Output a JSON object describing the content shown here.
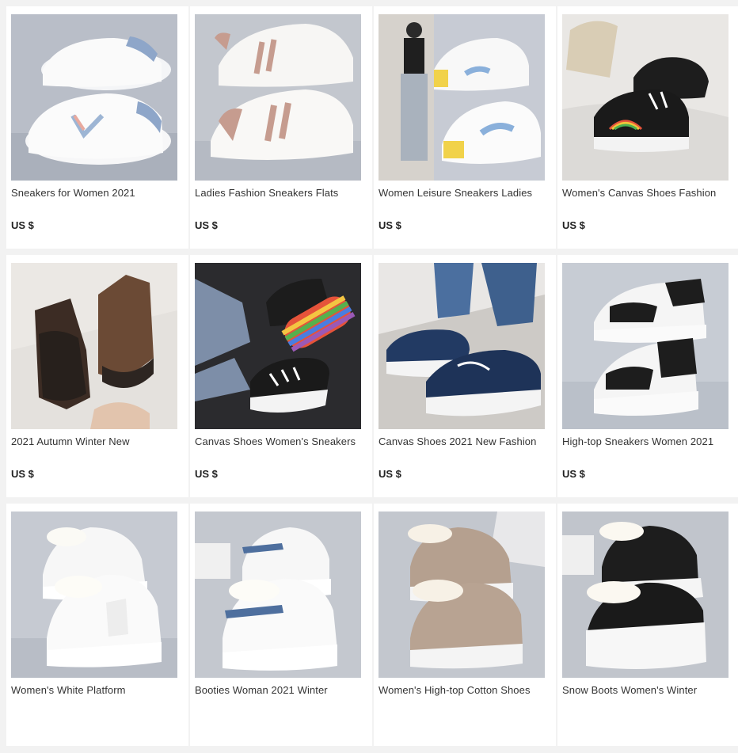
{
  "products": [
    {
      "title": "Sneakers for Women 2021",
      "price": "US $",
      "image_icon": "white-sneaker-blue-v-image"
    },
    {
      "title": "Ladies Fashion Sneakers Flats",
      "price": "US $",
      "image_icon": "white-sneaker-pink-stripes-image"
    },
    {
      "title": "Women Leisure Sneakers Ladies",
      "price": "US $",
      "image_icon": "white-sneaker-yellow-blue-image"
    },
    {
      "title": "Women's Canvas Shoes Fashion",
      "price": "US $",
      "image_icon": "black-canvas-rainbow-image"
    },
    {
      "title": "2021 Autumn Winter New",
      "price": "US $",
      "image_icon": "brown-chelsea-boot-image"
    },
    {
      "title": "Canvas Shoes Women's Sneakers",
      "price": "US $",
      "image_icon": "black-canvas-rainbow-sole-image"
    },
    {
      "title": "Canvas Shoes 2021 New Fashion",
      "price": "US $",
      "image_icon": "navy-denim-slipon-image"
    },
    {
      "title": "High-top Sneakers Women 2021",
      "price": "US $",
      "image_icon": "black-white-hightop-image"
    },
    {
      "title": "Women's White Platform",
      "price": "",
      "image_icon": "white-plush-hightop-image"
    },
    {
      "title": "Booties Woman 2021 Winter",
      "price": "",
      "image_icon": "white-blue-plush-boot-image"
    },
    {
      "title": "Women's High-top Cotton Shoes",
      "price": "",
      "image_icon": "beige-suede-plush-boot-image"
    },
    {
      "title": "Snow Boots Women's Winter",
      "price": "",
      "image_icon": "black-white-snow-boot-image"
    }
  ],
  "colors": {
    "page_bg": "#f2f2f2",
    "card_bg": "#ffffff",
    "title_text": "#333333",
    "price_text": "#222222"
  }
}
